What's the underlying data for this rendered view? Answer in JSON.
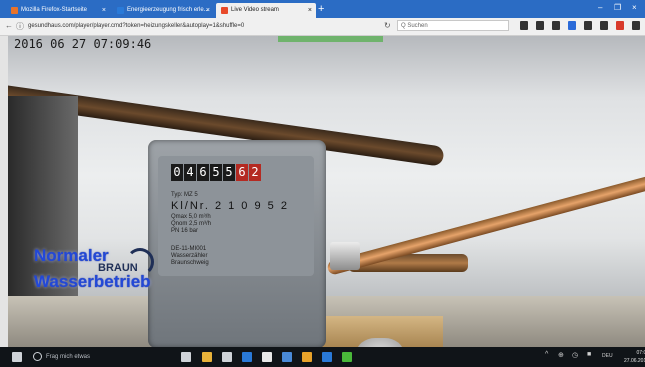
{
  "browser": {
    "tabs": [
      {
        "label": "Mozilla Firefox-Startseite",
        "favicon_color": "#e8732a"
      },
      {
        "label": "Energieerzeugung frisch erle...",
        "favicon_color": "#2a7ad8"
      },
      {
        "label": "Live Video stream",
        "favicon_color": "#e84a2a",
        "active": true
      }
    ],
    "new_tab": "+",
    "window_controls": [
      "–",
      "❐",
      "×"
    ],
    "url": "gesundhaus.com/player/player.cmd?token=heizungskeller&autoplay=1&shuffle=0",
    "search_placeholder": "Q Suchen",
    "toolbar_icon_colors": [
      "#333333",
      "#333333",
      "#333333",
      "#2a6ad8",
      "#333333",
      "#333333",
      "#d83a2a",
      "#333333"
    ]
  },
  "video": {
    "timestamp": "2016 06 27 07:09:46",
    "counter_digits": [
      "0",
      "4",
      "6",
      "5",
      "5",
      "6",
      "2"
    ],
    "meter_label_lines": [
      "Typ: MZ 5",
      "Kl/Nr. 2 1 0 9 5 2",
      "Qmax 5,0 m³/h",
      "Qnom 2,5 m³/h",
      "PN 16 bar",
      "DE-11-MI001",
      "Wasserzähler",
      "Braunschweig"
    ],
    "brand": "BRAUN",
    "overlay_line1": "Normaler",
    "overlay_line2": "Wasserbetrieb"
  },
  "taskbar": {
    "search_placeholder": "Frag mich etwas",
    "app_icon_colors": [
      "#cfd3d8",
      "#cfd3d8",
      "#e8b23a",
      "#cfd3d8",
      "#2a7ad8",
      "#e8e8e8",
      "#4a8ad8",
      "#e8a22a",
      "#2a7ad8",
      "#4ab83a"
    ],
    "tray_icons": [
      "^",
      "⊕",
      "◷",
      "■",
      "DEU"
    ],
    "time": "07:09",
    "date": "27.06.2016"
  }
}
